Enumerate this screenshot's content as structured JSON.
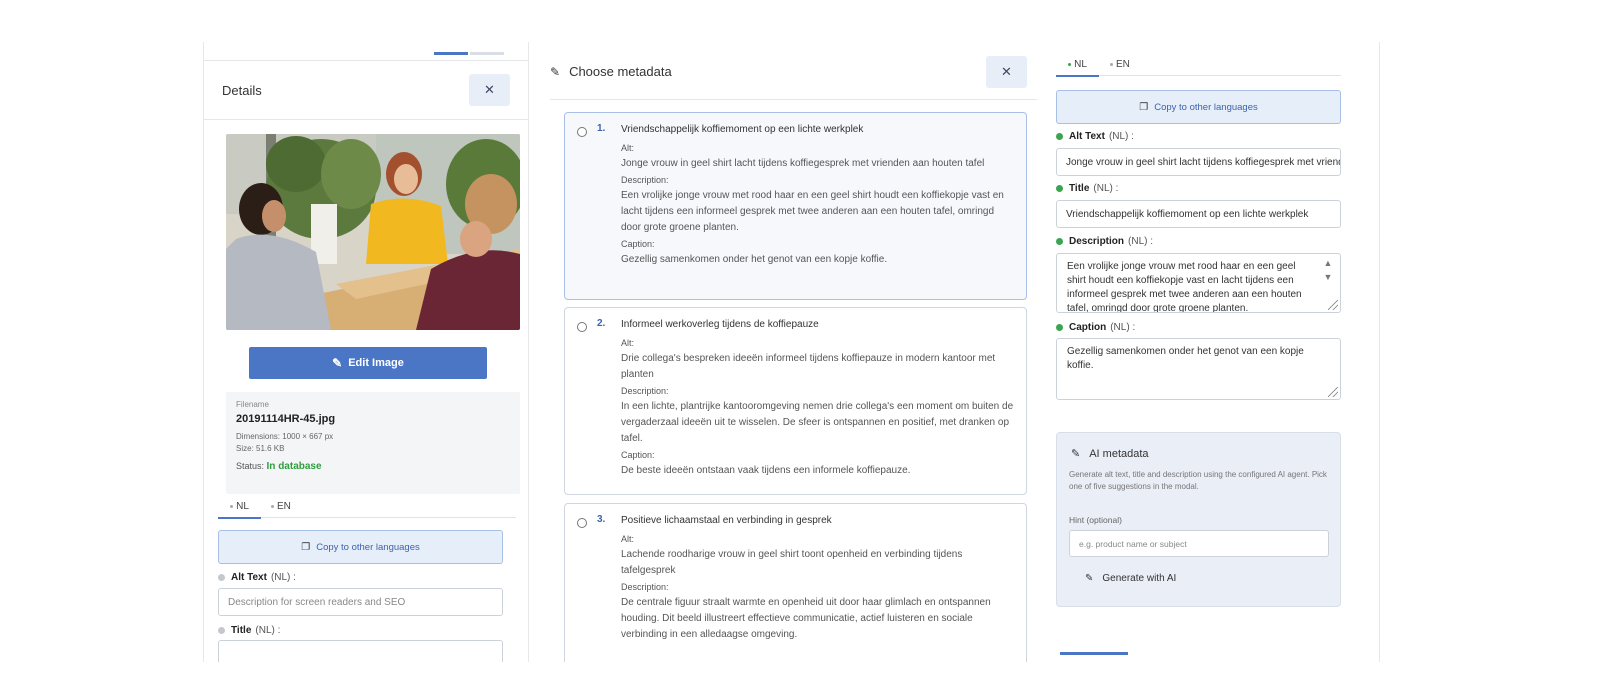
{
  "colors": {
    "accent": "#4a76c5",
    "success": "#2e9e3e",
    "status_green": "#3aa44f",
    "status_grey": "#c4c7cc"
  },
  "left": {
    "panel_title": "Details",
    "close_icon": "close-icon",
    "edit_image_label": "Edit Image",
    "file": {
      "label": "Filename",
      "name": "20191114HR-45.jpg",
      "dimensions": "Dimensions: 1000 × 667 px",
      "size": "Size: 51.6 KB",
      "status_label": "Status:",
      "status_value": "In database"
    },
    "tabs": [
      {
        "label": "NL"
      },
      {
        "label": "EN"
      }
    ],
    "copy_label": "Copy to other languages",
    "alt_label": "Alt Text",
    "alt_suffix": "(NL) :",
    "alt_placeholder": "Description for screen readers and SEO",
    "title_label": "Title",
    "title_suffix": "(NL) :"
  },
  "modal": {
    "title": "Choose metadata",
    "labels": {
      "alt": "Alt:",
      "description": "Description:",
      "caption": "Caption:"
    },
    "options": [
      {
        "num": "1.",
        "title": "Vriendschappelijk koffiemoment op een lichte werkplek",
        "alt": "Jonge vrouw in geel shirt lacht tijdens koffiegesprek met vrienden aan houten tafel",
        "description": "Een vrolijke jonge vrouw met rood haar en een geel shirt houdt een koffiekopje vast en lacht tijdens een informeel gesprek met twee anderen aan een houten tafel, omringd door grote groene planten.",
        "caption": "Gezellig samenkomen onder het genot van een kopje koffie."
      },
      {
        "num": "2.",
        "title": "Informeel werkoverleg tijdens de koffiepauze",
        "alt": "Drie collega's bespreken ideeën informeel tijdens koffiepauze in modern kantoor met planten",
        "description": "In een lichte, plantrijke kantooromgeving nemen drie collega's een moment om buiten de vergaderzaal ideeën uit te wisselen. De sfeer is ontspannen en positief, met dranken op tafel.",
        "caption": "De beste ideeën ontstaan vaak tijdens een informele koffiepauze."
      },
      {
        "num": "3.",
        "title": "Positieve lichaamstaal en verbinding in gesprek",
        "alt": "Lachende roodharige vrouw in geel shirt toont openheid en verbinding tijdens tafelgesprek",
        "description": "De centrale figuur straalt warmte en openheid uit door haar glimlach en ontspannen houding. Dit beeld illustreert effectieve communicatie, actief luisteren en sociale verbinding in een alledaagse omgeving."
      }
    ]
  },
  "right": {
    "tabs": [
      {
        "label": "NL"
      },
      {
        "label": "EN"
      }
    ],
    "copy_label": "Copy to other languages",
    "fields": {
      "alt": {
        "label": "Alt Text",
        "suffix": "(NL) :",
        "value": "Jonge vrouw in geel shirt lacht tijdens koffiegesprek met vrienden aan houten tafel"
      },
      "title": {
        "label": "Title",
        "suffix": "(NL) :",
        "value": "Vriendschappelijk koffiemoment op een lichte werkplek"
      },
      "description": {
        "label": "Description",
        "suffix": "(NL) :",
        "value": "Een vrolijke jonge vrouw met rood haar en een geel shirt houdt een koffiekopje vast en lacht tijdens een informeel gesprek met twee anderen aan een houten tafel, omringd door grote groene planten."
      },
      "caption": {
        "label": "Caption",
        "suffix": "(NL) :",
        "value": "Gezellig samenkomen onder het genot van een kopje koffie."
      }
    },
    "ai": {
      "title": "AI metadata",
      "description": "Generate alt text, title and description using the configured AI agent. Pick one of five suggestions in the modal.",
      "hint_label": "Hint (optional)",
      "hint_placeholder": "e.g. product name or subject",
      "generate_label": "Generate with AI"
    }
  }
}
